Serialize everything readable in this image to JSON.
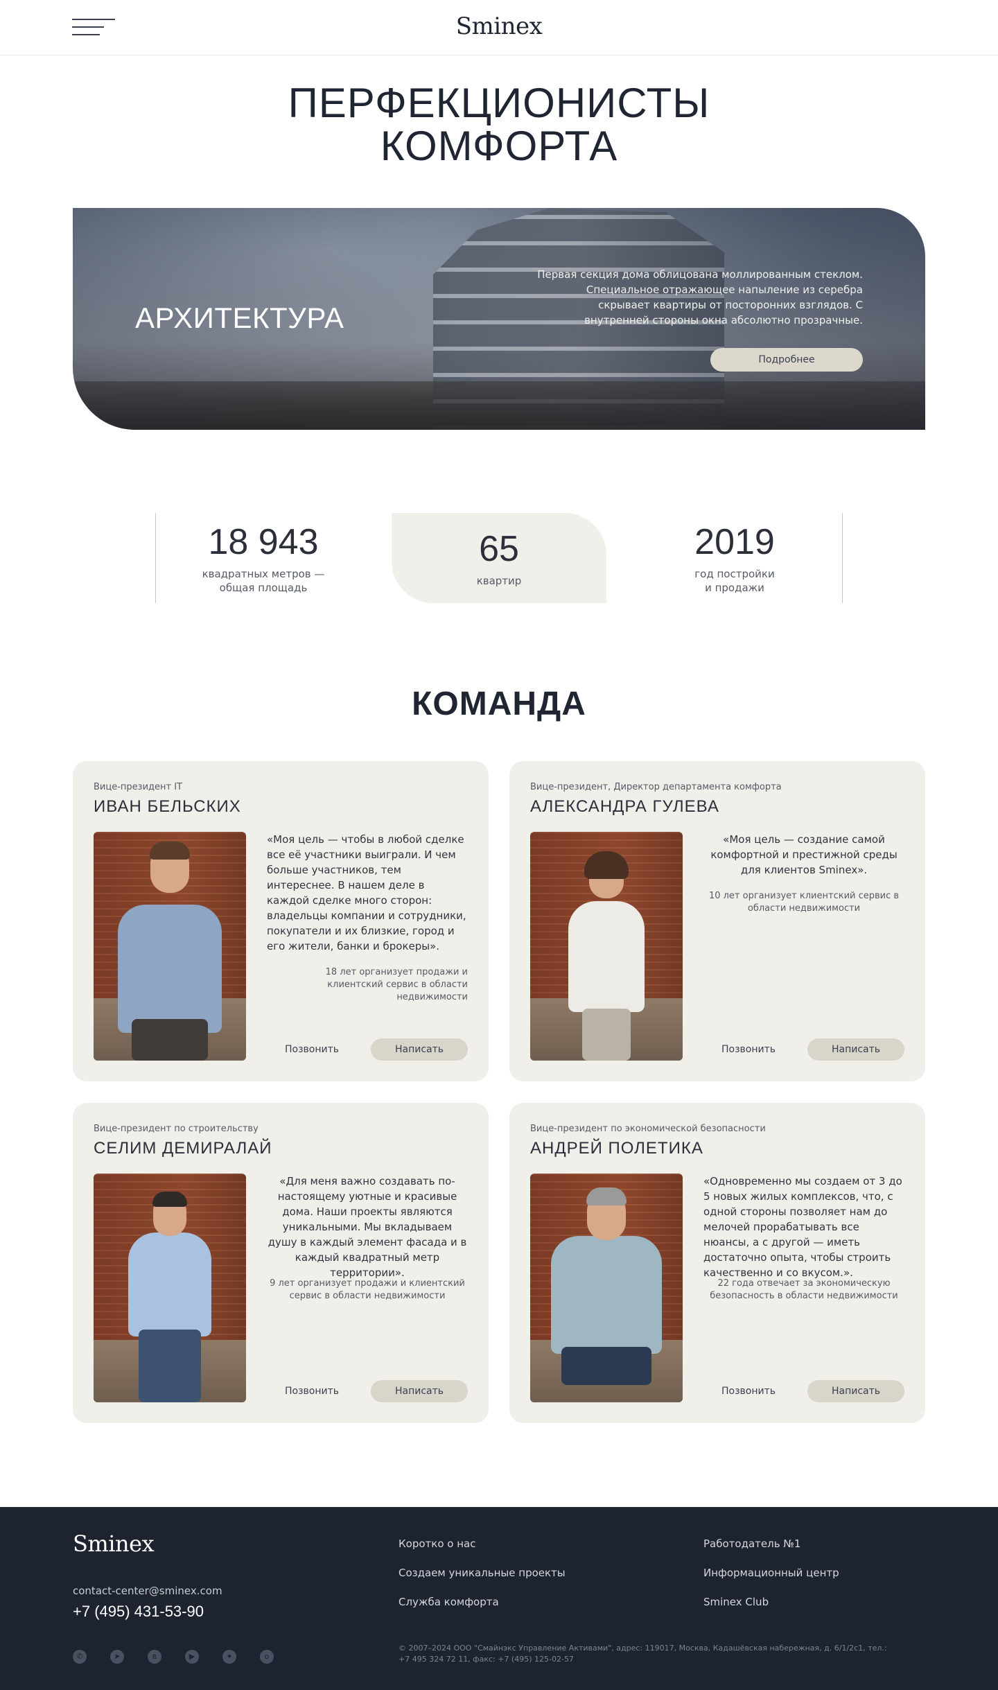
{
  "header": {
    "logo": "Sminex"
  },
  "hero": {
    "title_line1": "ПЕРФЕКЦИОНИСТЫ",
    "title_line2": "КОМФОРТА"
  },
  "banner": {
    "title": "АРХИТЕКТУРА",
    "text": "Первая секция дома облицована моллированным стеклом. Специальное отражающее напыление из серебра скрывает квартиры от посторонних взглядов. С внутренней стороны окна абсолютно прозрачные.",
    "button": "Подробнее"
  },
  "stats": [
    {
      "value": "18 943",
      "label_line1": "квадратных метров —",
      "label_line2": "общая площадь"
    },
    {
      "value": "65",
      "label_line1": "квартир",
      "label_line2": ""
    },
    {
      "value": "2019",
      "label_line1": "год постройки",
      "label_line2": "и продажи"
    }
  ],
  "team": {
    "title": "КОМАНДА",
    "call_label": "Позвонить",
    "write_label": "Написать",
    "members": [
      {
        "role": "Вице-президент IT",
        "name": "ИВАН БЕЛЬСКИХ",
        "quote": "«Моя цель — чтобы в любой сделке все её участники выиграли. И чем больше участников, тем интереснее. В нашем деле в каждой сделке много сторон: владельцы компании и сотрудники, покупатели и их близкие, город и его жители, банки и брокеры».",
        "note": "18 лет организует продажи и клиентский сервис в области недвижимости"
      },
      {
        "role": "Вице-президент, Директор департамента комфорта",
        "name": "АЛЕКСАНДРА ГУЛЕВА",
        "quote": "«Моя цель — создание самой комфортной и престижной среды для клиентов Sminex».",
        "note": "10 лет организует клиентский сервис в области недвижимости"
      },
      {
        "role": "Вице-президент по строительству",
        "name": "СЕЛИМ ДЕМИРАЛАЙ",
        "quote": "«Для меня важно создавать по-настоящему уютные и красивые дома. Наши проекты являются уникальными. Мы вкладываем душу в каждый элемент фасада и в каждый квадратный метр территории».",
        "note": "9 лет организует продажи и клиентский сервис в области недвижимости"
      },
      {
        "role": "Вице-президент по экономической безопасности",
        "name": "АНДРЕЙ ПОЛЕТИКА",
        "quote": "«Одновременно мы создаем от 3 до 5 новых жилых комплексов, что, с одной стороны позволяет нам до мелочей прорабатывать все нюансы, а с другой — иметь достаточно опыта, чтобы строить качественно и со вкусом.».",
        "note": "22 года отвечает за экономическую безопасность в области недвижимости"
      }
    ]
  },
  "footer": {
    "logo": "Sminex",
    "email": "contact-center@sminex.com",
    "phone": "+7 (495) 431-53-90",
    "links_col1": [
      "Коротко о нас",
      "Создаем уникальные проекты",
      "Служба комфорта"
    ],
    "links_col2": [
      "Работодатель №1",
      "Информационный центр",
      "Sminex Club"
    ],
    "copyright": "© 2007–2024 ООО \"Смайнэкс Управление Активами\", адрес: 119017, Москва, Кадашёвская набережная, д. 6/1/2с1, тел.: +7 495 324 72 11, факс: +7 (495) 125-02-57",
    "socials": [
      "whatsapp-icon",
      "telegram-icon",
      "vk-icon",
      "youtube-icon",
      "zen-icon",
      "odnoklassniki-icon"
    ]
  }
}
